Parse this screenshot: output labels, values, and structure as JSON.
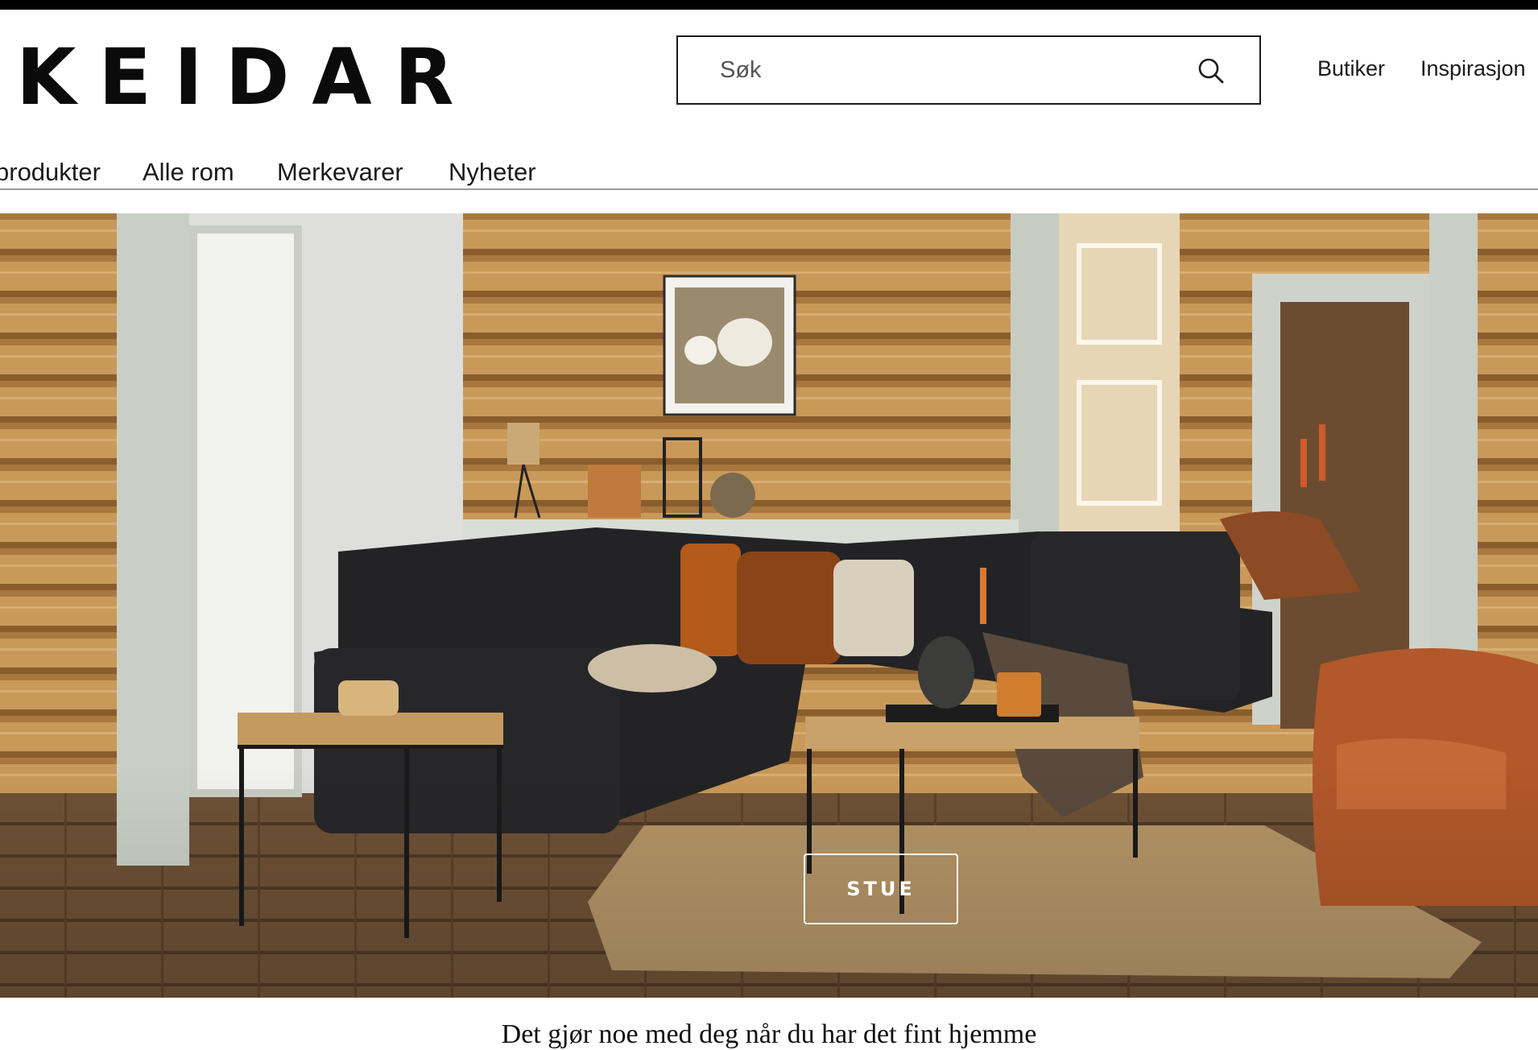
{
  "brand": {
    "logo_text": "KEIDAR"
  },
  "search": {
    "placeholder": "Søk",
    "icon": "search-icon"
  },
  "utility_nav": [
    {
      "label": "Butiker"
    },
    {
      "label": "Inspirasjon"
    }
  ],
  "main_nav": [
    {
      "label": "produkter"
    },
    {
      "label": "Alle rom"
    },
    {
      "label": "Merkevarer"
    },
    {
      "label": "Nyheter"
    }
  ],
  "hero": {
    "image_subject": "living room with dark corner sofa, log walls, coffee tables and orange armchair",
    "cta_label": "STUE"
  },
  "intro": {
    "tagline": "Det gjør noe med deg når du har det fint hjemme"
  },
  "colors": {
    "text": "#111111",
    "top_bar": "#000000",
    "border": "#1a1a1a",
    "nav_divider": "#9a9a9a"
  }
}
